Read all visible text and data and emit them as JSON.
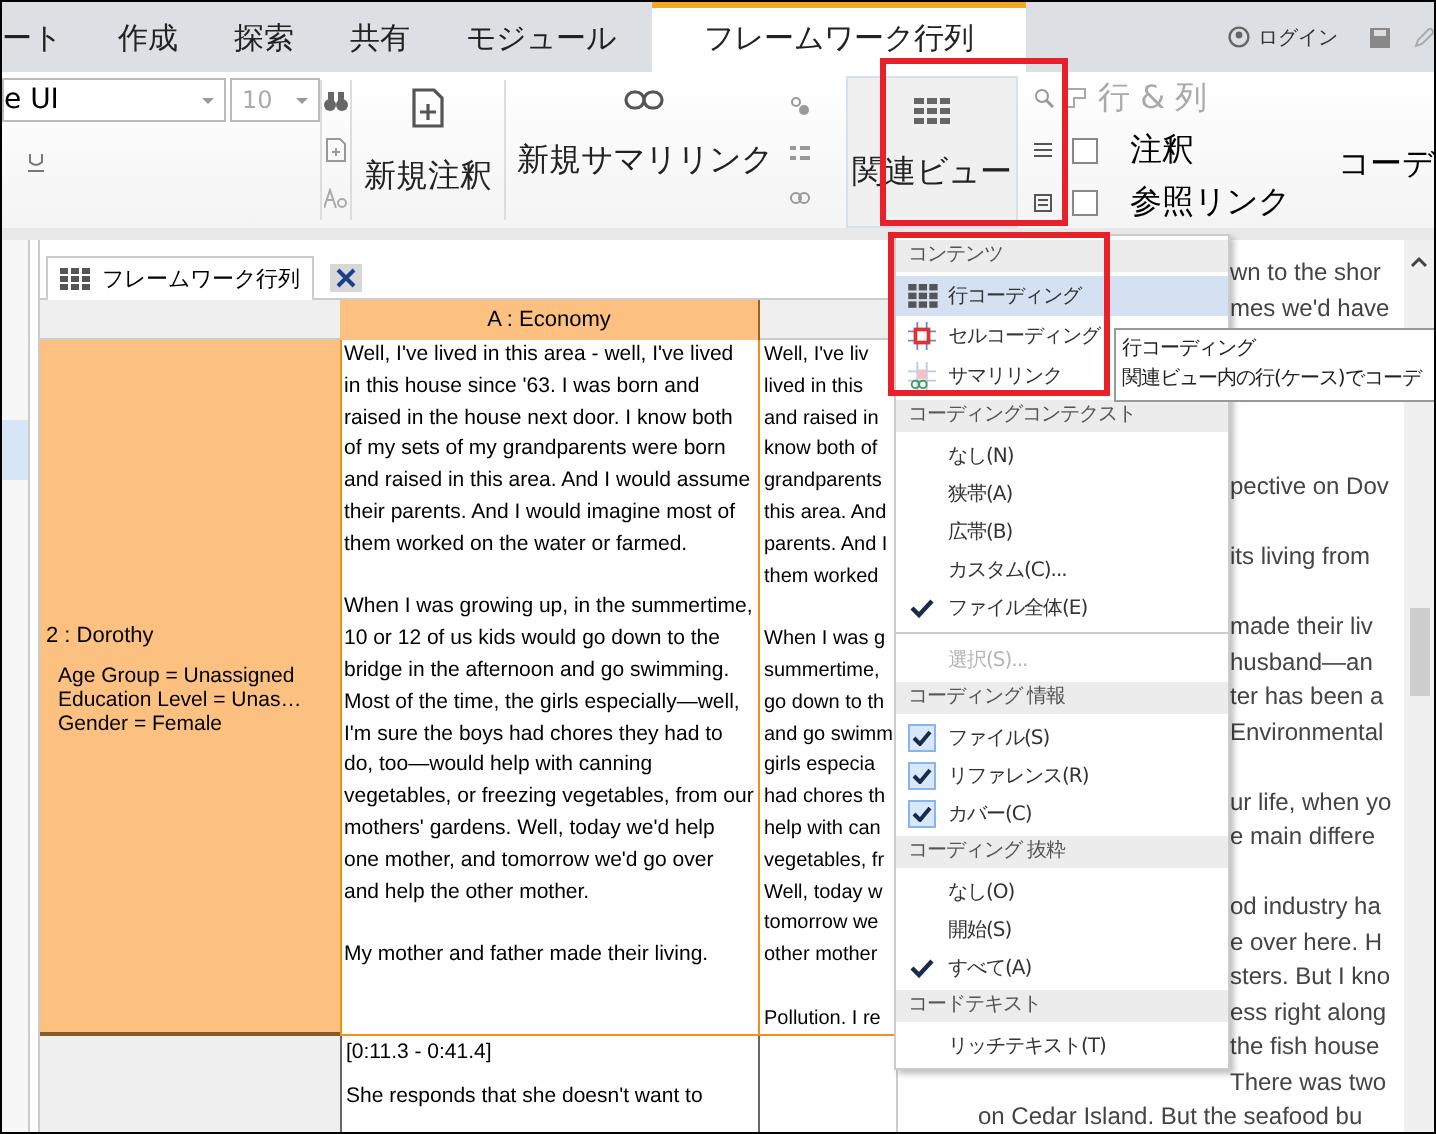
{
  "tabs": [
    {
      "label": "ート",
      "selected": false
    },
    {
      "label": "作成",
      "selected": false
    },
    {
      "label": "探索",
      "selected": false
    },
    {
      "label": "共有",
      "selected": false
    },
    {
      "label": "モジュール",
      "selected": false
    },
    {
      "label": "フレームワーク行列",
      "selected": true
    }
  ],
  "account": {
    "login": "ログイン"
  },
  "ribbon": {
    "font_name": "e UI",
    "font_size": "10",
    "new_annotation": "新規注釈",
    "new_summary_link": "新規サマリリンク",
    "related_view": "関連ビュー",
    "rows_columns": "行 & 列",
    "checks": [
      {
        "label": "注釈",
        "checked": false
      },
      {
        "label": "参照リンク",
        "checked": false
      }
    ],
    "cut_label": "コーデ"
  },
  "document_tab": {
    "title": "フレームワーク行列"
  },
  "matrix": {
    "column_a": "A : Economy",
    "row_header": "2 : Dorothy",
    "attributes": [
      "Age Group = Unassigned",
      "Education Level = Unas…",
      "Gender = Female"
    ],
    "cell_paragraphs": [
      "Well, I've lived in this area - well, I've lived in this house since '63. I was born and raised in the house next door. I know both of my sets of my grandparents were born and raised in this area. And I would assume their parents. And I would imagine most of them worked on the water or farmed.",
      "When I was growing up, in the summertime, 10 or 12 of us kids would go down to the bridge in the afternoon and go swimming. Most of the time, the girls especially—well, I'm sure the boys had chores they had to do, too—would help with canning vegetables, or freezing vegetables, from our mothers' gardens. Well, today we'd help one mother, and tomorrow we'd go over and help the other mother.",
      "My mother and father made their living."
    ],
    "column_3_paragraphs": [
      [
        "Well, I've liv",
        "lived in this",
        "and raised in",
        "know both of",
        "grandparents",
        "this area. And",
        "parents. And I",
        "them worked"
      ],
      [
        "When I was g",
        "summertime,",
        "go down to th",
        "and go swimm",
        "girls especia",
        "had chores th",
        "help with can",
        "vegetables, fr",
        "Well, today w",
        "tomorrow we",
        "other mother"
      ],
      [
        "Pollution. I re"
      ]
    ],
    "next_row": {
      "timestamp": "[0:11.3 - 0:41.4]",
      "summary": "She responds that she doesn't want to"
    }
  },
  "side_text": {
    "top_lines": [
      "wn to the shor",
      "mes we'd have"
    ],
    "paragraphs": [
      [
        "pective on Dov"
      ],
      [
        "its living from"
      ],
      [
        "made their liv",
        "husband—an",
        "ter has been a",
        "Environmental"
      ],
      [
        "ur life, when yo",
        "e main differe"
      ],
      [
        "od industry ha",
        "e over here. H",
        "sters. But I kno",
        "ess right along",
        "the fish house",
        "There was two"
      ]
    ],
    "bottom_line": "on Cedar Island. But the seafood bu"
  },
  "menu": [
    {
      "kind": "header",
      "label": "コンテンツ"
    },
    {
      "kind": "icon",
      "label": "行コーディング",
      "selected": true
    },
    {
      "kind": "icon",
      "label": "セルコーディング",
      "selected": false
    },
    {
      "kind": "icon",
      "label": "サマリリンク",
      "selected": false
    },
    {
      "kind": "header",
      "label": "コーディングコンテクスト"
    },
    {
      "kind": "radio",
      "label": "なし(N)",
      "checked": false
    },
    {
      "kind": "radio",
      "label": "狭帯(A)",
      "checked": false
    },
    {
      "kind": "radio",
      "label": "広帯(B)",
      "checked": false
    },
    {
      "kind": "radio",
      "label": "カスタム(C)...",
      "checked": false
    },
    {
      "kind": "radio",
      "label": "ファイル全体(E)",
      "checked": true
    },
    {
      "kind": "separator"
    },
    {
      "kind": "radio",
      "label": "選択(S)...",
      "checked": false,
      "disabled": true
    },
    {
      "kind": "header",
      "label": "コーディング 情報"
    },
    {
      "kind": "toggle",
      "label": "ファイル(S)",
      "checked": true
    },
    {
      "kind": "toggle",
      "label": "リファレンス(R)",
      "checked": true
    },
    {
      "kind": "toggle",
      "label": "カバー(C)",
      "checked": true
    },
    {
      "kind": "header",
      "label": "コーディング 抜粋"
    },
    {
      "kind": "radio",
      "label": "なし(O)",
      "checked": false
    },
    {
      "kind": "radio",
      "label": "開始(S)",
      "checked": false
    },
    {
      "kind": "radio",
      "label": "すべて(A)",
      "checked": true
    },
    {
      "kind": "header",
      "label": "コードテキスト"
    },
    {
      "kind": "radio",
      "label": "リッチテキスト(T)",
      "checked": false
    }
  ],
  "tooltip": {
    "title": "行コーディング",
    "text": "関連ビュー内の行(ケース)でコーデ"
  }
}
